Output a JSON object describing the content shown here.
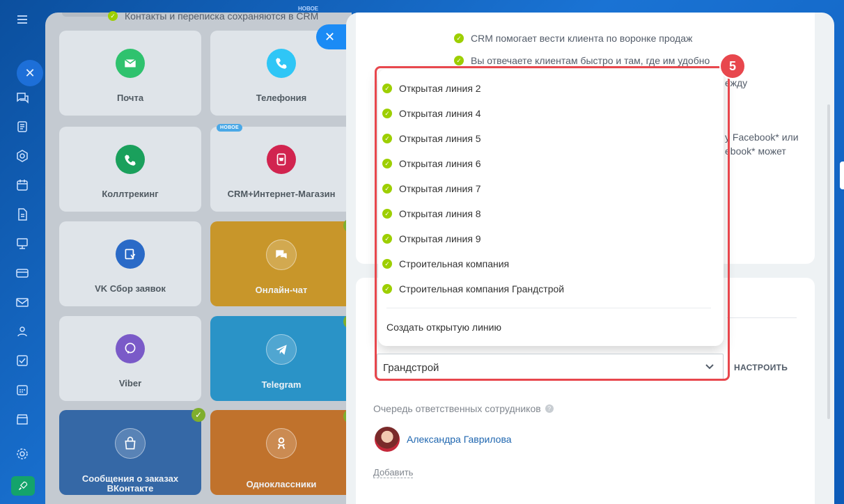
{
  "gallery": {
    "new_top_badge": "НОВОЕ",
    "tiles": [
      {
        "label": "Почта",
        "icon": "mail-icon",
        "color": "#2fc26e"
      },
      {
        "label": "Телефония",
        "icon": "phone-icon",
        "color": "#2fc6f6"
      },
      {
        "label": "Коллтрекинг",
        "icon": "calltracking-icon",
        "color": "#1aa05c"
      },
      {
        "label": "CRM+Интернет-Магазин",
        "icon": "shop-cart-icon",
        "color": "#d1244f",
        "badge": "НОВОЕ"
      },
      {
        "label": "VK Сбор заявок",
        "icon": "vk-form-icon",
        "color": "#2a6ac7"
      },
      {
        "label": "Онлайн-чат",
        "icon": "chat-icon",
        "color": "#d6a12a"
      },
      {
        "label": "Viber",
        "icon": "viber-icon",
        "color": "#7a5ac8"
      },
      {
        "label": "Telegram",
        "icon": "telegram-icon",
        "color": "#2fa4d8"
      },
      {
        "label": "Сообщения о заказах ВКонтакте",
        "icon": "vk-shop-icon",
        "color": "#3a6bab"
      },
      {
        "label": "Одноклассники",
        "icon": "ok-icon",
        "color": "#c4762e"
      }
    ]
  },
  "features": [
    "Контакты и переписка сохраняются в CRM",
    "CRM помогает вести клиента по воронке продаж",
    "Вы отвечаете клиентам быстро и там, где им удобно"
  ],
  "ghost_text": [
    "ежду",
    "y Facebook* или",
    "ebook* может"
  ],
  "dropdown": {
    "options": [
      "Открытая линия 2",
      "Открытая линия 4",
      "Открытая линия 5",
      "Открытая линия 6",
      "Открытая линия 7",
      "Открытая линия 8",
      "Открытая линия 9",
      "Строительная компания",
      "Строительная компания Грандстрой"
    ],
    "create_label": "Создать открытую линию"
  },
  "select": {
    "value": "Грандстрой",
    "configure_label": "НАСТРОИТЬ"
  },
  "step_number": "5",
  "queue": {
    "label": "Очередь ответственных сотрудников",
    "help": "?",
    "user_name": "Александра Гаврилова",
    "add_label": "Добавить"
  },
  "colors": {
    "accent_red": "#e8474d",
    "check_green": "#9dcf00",
    "link_blue": "#2067b0"
  }
}
